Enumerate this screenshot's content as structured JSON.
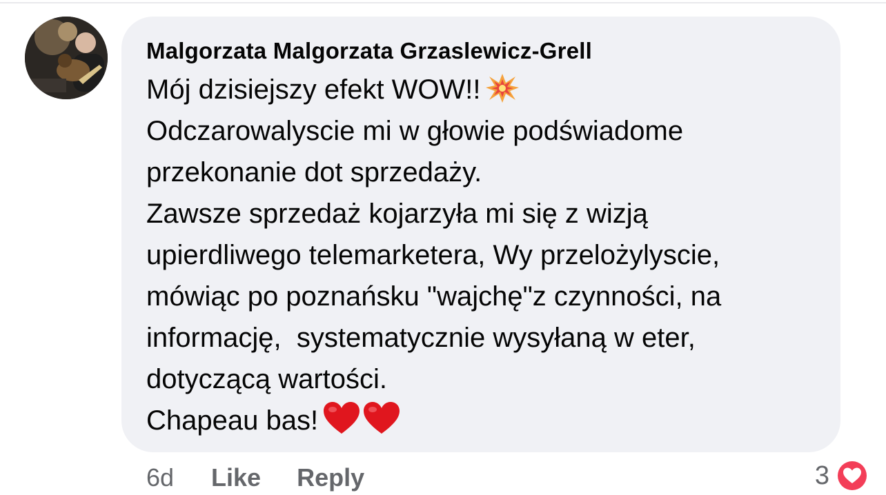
{
  "comment": {
    "author": "Malgorzata Malgorzata Grzaslewicz-Grell",
    "lines": [
      "Mój dzisiejszy efekt WOW!!",
      "Odczarowalyscie mi w głowie podświadome",
      "przekonanie dot sprzedaży.",
      "Zawsze sprzedaż kojarzyła mi się z wizją",
      "upierdliwego telemarketera, Wy przelożylyscie,",
      "mówiąc po poznańsku \"wajchę\"z czynności, na",
      "informację,  systematycznie wysyłaną w eter,",
      "dotyczącą wartości.",
      "Chapeau bas!"
    ],
    "icons": {
      "line0_emoji": "collision-emoji",
      "line8_emoji": "red-heart-emoji"
    }
  },
  "actions": {
    "timestamp": "6d",
    "like_label": "Like",
    "reply_label": "Reply"
  },
  "reactions": {
    "count": "3",
    "type": "love",
    "color": "#f33e58"
  }
}
